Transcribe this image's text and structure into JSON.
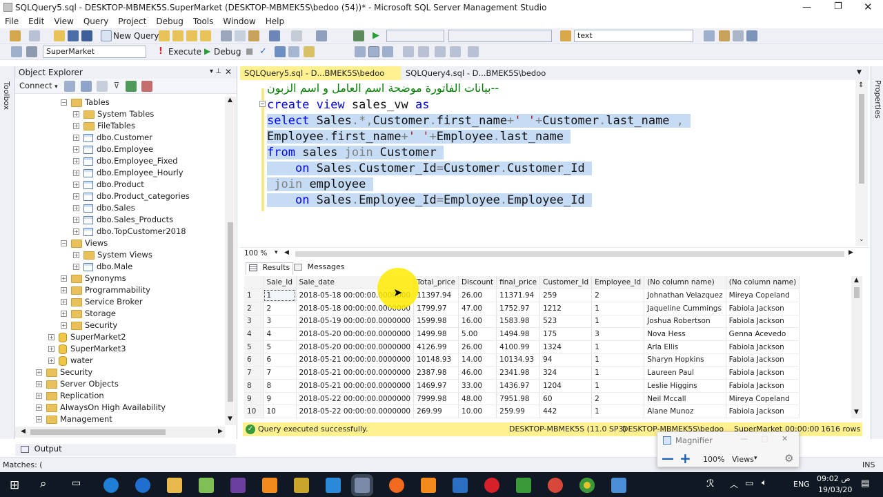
{
  "window": {
    "title": "SQLQuery5.sql - DESKTOP-MBMEK5S.SuperMarket (DESKTOP-MBMEK5S\\bedoo (54))* - Microsoft SQL Server Management Studio"
  },
  "menu": [
    "File",
    "Edit",
    "View",
    "Query",
    "Project",
    "Debug",
    "Tools",
    "Window",
    "Help"
  ],
  "toolbar": {
    "new_query": "New Query",
    "find_text": "text",
    "database": "SuperMarket",
    "execute": "Execute",
    "debug": "Debug"
  },
  "left_strip": {
    "label": "Toolbox"
  },
  "right_strip": {
    "label": "Properties"
  },
  "object_explorer": {
    "title": "Object Explorer",
    "connect": "Connect",
    "nodes": [
      {
        "label": "Tables",
        "icon": "folder",
        "exp": "−"
      },
      {
        "label": "System Tables",
        "icon": "folder",
        "exp": "+"
      },
      {
        "label": "FileTables",
        "icon": "folder",
        "exp": "+"
      },
      {
        "label": "dbo.Customer",
        "icon": "table",
        "exp": "+"
      },
      {
        "label": "dbo.Employee",
        "icon": "table",
        "exp": "+"
      },
      {
        "label": "dbo.Employee_Fixed",
        "icon": "table",
        "exp": "+"
      },
      {
        "label": "dbo.Employee_Hourly",
        "icon": "table",
        "exp": "+"
      },
      {
        "label": "dbo.Product",
        "icon": "table",
        "exp": "+"
      },
      {
        "label": "dbo.Product_categories",
        "icon": "table",
        "exp": "+"
      },
      {
        "label": "dbo.Sales",
        "icon": "table",
        "exp": "+"
      },
      {
        "label": "dbo.Sales_Products",
        "icon": "table",
        "exp": "+"
      },
      {
        "label": "dbo.TopCustomer2018",
        "icon": "table",
        "exp": "+"
      },
      {
        "label": "Views",
        "icon": "folder",
        "exp": "−"
      },
      {
        "label": "System Views",
        "icon": "folder",
        "exp": "+"
      },
      {
        "label": "dbo.Male",
        "icon": "table",
        "exp": "+"
      },
      {
        "label": "Synonyms",
        "icon": "folder",
        "exp": "+"
      },
      {
        "label": "Programmability",
        "icon": "folder",
        "exp": "+"
      },
      {
        "label": "Service Broker",
        "icon": "folder",
        "exp": "+"
      },
      {
        "label": "Storage",
        "icon": "folder",
        "exp": "+"
      },
      {
        "label": "Security",
        "icon": "folder",
        "exp": "+"
      },
      {
        "label": "SuperMarket2",
        "icon": "db",
        "exp": "+"
      },
      {
        "label": "SuperMarket3",
        "icon": "db",
        "exp": "+"
      },
      {
        "label": "water",
        "icon": "db",
        "exp": "+"
      },
      {
        "label": "Security",
        "icon": "folder",
        "exp": "+"
      },
      {
        "label": "Server Objects",
        "icon": "folder",
        "exp": "+"
      },
      {
        "label": "Replication",
        "icon": "folder",
        "exp": "+"
      },
      {
        "label": "AlwaysOn High Availability",
        "icon": "folder",
        "exp": "+"
      },
      {
        "label": "Management",
        "icon": "folder",
        "exp": "+"
      }
    ]
  },
  "tabs": [
    {
      "label": "SQLQuery5.sql - D...BMEK5S\\bedoo (54))*"
    },
    {
      "label": "SQLQuery4.sql - D...BMEK5S\\bedoo (51))*"
    }
  ],
  "editor": {
    "comment": "--بيانات الفاتورة موضحة اسم العامل و اسم الزبون",
    "lines": [
      "create view sales_vw as",
      "select Sales.*,Customer.first_name+' '+Customer.last_name ,",
      "Employee.first_name+' '+Employee.last_name",
      "from sales join Customer",
      "    on Sales.Customer_Id=Customer.Customer_Id",
      " join employee",
      "    on Sales.Employee_Id=Employee.Employee_Id"
    ],
    "zoom": "100 %"
  },
  "results": {
    "tab_results": "Results",
    "tab_messages": "Messages",
    "columns": [
      "Sale_Id",
      "Sale_date",
      "Total_price",
      "Discount",
      "final_price",
      "Customer_Id",
      "Employee_Id",
      "(No column name)",
      "(No column name)"
    ],
    "rows": [
      [
        "1",
        "1",
        "2018-05-18 00:00:00.0000000",
        "11397.94",
        "26.00",
        "11371.94",
        "259",
        "2",
        "Johnathan Velazquez",
        "Mireya Copeland"
      ],
      [
        "2",
        "2",
        "2018-05-18 00:00:00.0000000",
        "1799.97",
        "47.00",
        "1752.97",
        "1212",
        "1",
        "Jaqueline Cummings",
        "Fabiola Jackson"
      ],
      [
        "3",
        "3",
        "2018-05-19 00:00:00.0000000",
        "1599.98",
        "16.00",
        "1583.98",
        "523",
        "1",
        "Joshua Robertson",
        "Fabiola Jackson"
      ],
      [
        "4",
        "4",
        "2018-05-20 00:00:00.0000000",
        "1499.98",
        "5.00",
        "1494.98",
        "175",
        "3",
        "Nova Hess",
        "Genna Acevedo"
      ],
      [
        "5",
        "5",
        "2018-05-20 00:00:00.0000000",
        "4126.99",
        "26.00",
        "4100.99",
        "1324",
        "1",
        "Arla Ellis",
        "Fabiola Jackson"
      ],
      [
        "6",
        "6",
        "2018-05-21 00:00:00.0000000",
        "10148.93",
        "14.00",
        "10134.93",
        "94",
        "1",
        "Sharyn Hopkins",
        "Fabiola Jackson"
      ],
      [
        "7",
        "7",
        "2018-05-21 00:00:00.0000000",
        "2387.98",
        "46.00",
        "2341.98",
        "324",
        "1",
        "Laureen Paul",
        "Fabiola Jackson"
      ],
      [
        "8",
        "8",
        "2018-05-21 00:00:00.0000000",
        "1469.97",
        "33.00",
        "1436.97",
        "1204",
        "1",
        "Leslie Higgins",
        "Fabiola Jackson"
      ],
      [
        "9",
        "9",
        "2018-05-22 00:00:00.0000000",
        "7999.98",
        "48.00",
        "7951.98",
        "60",
        "2",
        "Neil Mccall",
        "Mireya Copeland"
      ],
      [
        "10",
        "10",
        "2018-05-22 00:00:00.0000000",
        "269.99",
        "10.00",
        "259.99",
        "442",
        "1",
        "Alane Munoz",
        "Fabiola Jackson"
      ]
    ]
  },
  "query_status": {
    "message": "Query executed successfully.",
    "server": "DESKTOP-MBMEK5S (11.0 SP3)",
    "login": "DESKTOP-MBMEK5S\\bedoo",
    "db": "SuperMarket",
    "time": "00:00:00",
    "rows": "1616 rows"
  },
  "output": {
    "label": "Output"
  },
  "statusbar": {
    "left": "Matches: (",
    "right": "INS"
  },
  "magnifier": {
    "title": "Magnifier",
    "zoom": "100%",
    "views": "Views"
  },
  "taskbar": {
    "lang": "ENG",
    "time": "09:02 ص",
    "date": "19/03/20"
  },
  "colors": {
    "selection": "#c6dcf5",
    "keyword": "#0000ff",
    "status_yellow": "#fff18f",
    "taskbar": "#101923"
  }
}
